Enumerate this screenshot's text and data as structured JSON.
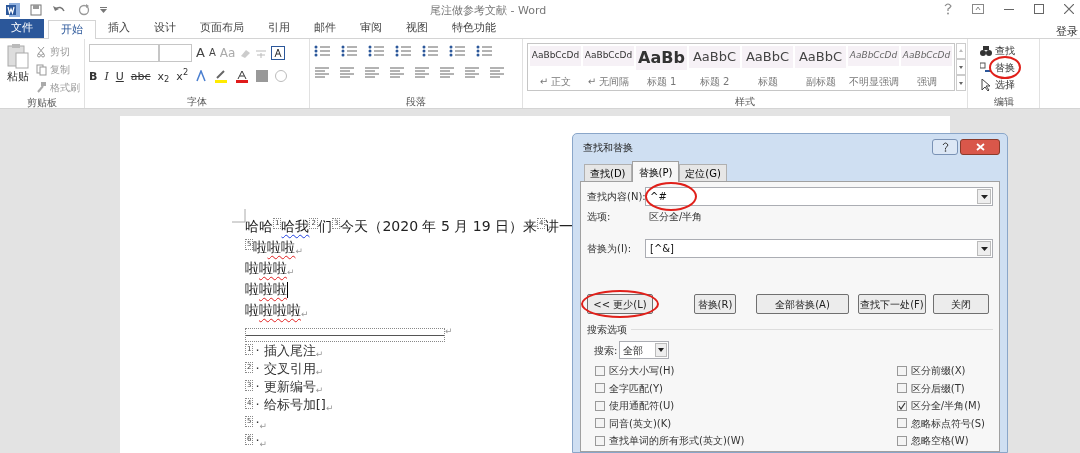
{
  "title_bar": {
    "title": "尾注做参考文献 - Word",
    "sign_in": "登录"
  },
  "tabs": [
    {
      "label": "文件",
      "kind": "file",
      "selected": false
    },
    {
      "label": "开始",
      "kind": "tab",
      "selected": true
    },
    {
      "label": "插入",
      "kind": "tab",
      "selected": false
    },
    {
      "label": "设计",
      "kind": "tab",
      "selected": false
    },
    {
      "label": "页面布局",
      "kind": "tab",
      "selected": false
    },
    {
      "label": "引用",
      "kind": "tab",
      "selected": false
    },
    {
      "label": "邮件",
      "kind": "tab",
      "selected": false
    },
    {
      "label": "审阅",
      "kind": "tab",
      "selected": false
    },
    {
      "label": "视图",
      "kind": "tab",
      "selected": false
    },
    {
      "label": "特色功能",
      "kind": "tab",
      "selected": false
    }
  ],
  "ribbon": {
    "clipboard": {
      "paste": "粘贴",
      "items": [
        "剪切",
        "复制",
        "格式刷"
      ],
      "label": "剪贴板"
    },
    "font": {
      "row1_text": [
        "A",
        "A",
        "Aa"
      ],
      "row2_text": [
        "B",
        "I",
        "U",
        "abc",
        "x$_{2}$",
        "x$^{2}$"
      ],
      "label": "字体"
    },
    "paragraph": {
      "label": "段落"
    },
    "styles": {
      "items": [
        {
          "sample": "AaBbCcDd",
          "name": "↵ 正文",
          "kind": "body"
        },
        {
          "sample": "AaBbCcDd",
          "name": "↵ 无间隔",
          "kind": "body"
        },
        {
          "sample": "AaBb",
          "name": "标题 1",
          "kind": "heading1"
        },
        {
          "sample": "AaBbC",
          "name": "标题 2",
          "kind": "heading"
        },
        {
          "sample": "AaBbC",
          "name": "标题",
          "kind": "heading"
        },
        {
          "sample": "AaBbC",
          "name": "副标题",
          "kind": "heading"
        },
        {
          "sample": "AaBbCcDd",
          "name": "不明显强调",
          "kind": "emphasis"
        },
        {
          "sample": "AaBbCcDd",
          "name": "强调",
          "kind": "emphasis"
        }
      ],
      "label": "样式"
    },
    "editing": {
      "items": [
        {
          "label": "查找",
          "kind": "find",
          "circled": false
        },
        {
          "label": "替换",
          "kind": "replace",
          "circled": true
        },
        {
          "label": "选择",
          "kind": "select",
          "circled": false
        }
      ],
      "label": "编辑"
    }
  },
  "document": {
    "lines": [
      {
        "segments": [
          {
            "kind": "text",
            "text": "哈哈",
            "spelling_error": false,
            "grammar_error": false
          },
          {
            "kind": "note_ref",
            "text": "1"
          },
          {
            "kind": "text",
            "text": "哈我",
            "spelling_error": false,
            "grammar_error": true
          },
          {
            "kind": "note_ref",
            "text": "2"
          },
          {
            "kind": "text",
            "text": "们",
            "spelling_error": false,
            "grammar_error": false
          },
          {
            "kind": "note_ref",
            "text": "3"
          },
          {
            "kind": "text",
            "text": "今天（2020 年 5 月 19 日）来",
            "spelling_error": false,
            "grammar_error": false
          },
          {
            "kind": "note_ref",
            "text": "4"
          },
          {
            "kind": "text",
            "text": "讲一",
            "spelling_error": false,
            "grammar_error": false
          }
        ],
        "cursor": false
      },
      {
        "segments": [
          {
            "kind": "note_ref",
            "text": "5"
          },
          {
            "kind": "text",
            "text": "啦",
            "spelling_error": false,
            "grammar_error": false
          },
          {
            "kind": "text",
            "text": "啦啦",
            "spelling_error": true,
            "grammar_error": false
          }
        ],
        "end_mark": "↵",
        "cursor": false
      },
      {
        "segments": [
          {
            "kind": "text",
            "text": "啦",
            "spelling_error": false,
            "grammar_error": false
          },
          {
            "kind": "text",
            "text": "啦啦",
            "spelling_error": true,
            "grammar_error": false
          }
        ],
        "end_mark": "↵",
        "cursor": false
      },
      {
        "segments": [
          {
            "kind": "text",
            "text": "啦",
            "spelling_error": false,
            "grammar_error": false
          },
          {
            "kind": "text",
            "text": "啦啦",
            "spelling_error": true,
            "grammar_error": false
          }
        ],
        "cursor": true
      },
      {
        "segments": [
          {
            "kind": "text",
            "text": "啦",
            "spelling_error": false,
            "grammar_error": false
          },
          {
            "kind": "text",
            "text": "啦啦啦",
            "spelling_error": true,
            "grammar_error": false
          }
        ],
        "end_mark": "↵",
        "cursor": false
      }
    ],
    "separator_mark": "↵",
    "notes": [
      {
        "ref": "1",
        "text": "· 插入尾注",
        "end_mark": "↵"
      },
      {
        "ref": "2",
        "text": "· 交叉引用",
        "end_mark": "↵"
      },
      {
        "ref": "3",
        "text": "· 更新编号",
        "end_mark": "↵"
      },
      {
        "ref": "4",
        "text": "· 给标号加[]",
        "end_mark": "↵"
      },
      {
        "ref": "5",
        "text": "·",
        "end_mark": "↵"
      },
      {
        "ref": "6",
        "text": "·",
        "end_mark": "↵"
      }
    ]
  },
  "dialog": {
    "title": "查找和替换",
    "tabs": [
      {
        "label": "查找(D)",
        "selected": false
      },
      {
        "label": "替换(P)",
        "selected": true
      },
      {
        "label": "定位(G)",
        "selected": false
      }
    ],
    "find": {
      "label": "查找内容(N):",
      "value": "^#",
      "circled": true
    },
    "options_label": "选项:",
    "options_value": "区分全/半角",
    "replace": {
      "label": "替换为(I):",
      "value": "[^&]"
    },
    "buttons": [
      {
        "label": "<< 更少(L)",
        "circled": true
      },
      {
        "label": "替换(R)",
        "circled": false
      },
      {
        "label": "全部替换(A)",
        "circled": false
      },
      {
        "label": "查找下一处(F)",
        "circled": false
      },
      {
        "label": "关闭",
        "circled": false
      }
    ],
    "search_options_title": "搜索选项",
    "search_label": "搜索:",
    "search_value": "全部",
    "left_options": [
      {
        "label": "区分大小写(H)",
        "checked": false
      },
      {
        "label": "全字匹配(Y)",
        "checked": false
      },
      {
        "label": "使用通配符(U)",
        "checked": false
      },
      {
        "label": "同音(英文)(K)",
        "checked": false
      },
      {
        "label": "查找单词的所有形式(英文)(W)",
        "checked": false
      }
    ],
    "right_options": [
      {
        "label": "区分前缀(X)",
        "checked": false
      },
      {
        "label": "区分后缀(T)",
        "checked": false
      },
      {
        "label": "区分全/半角(M)",
        "checked": true
      },
      {
        "label": "忽略标点符号(S)",
        "checked": false
      },
      {
        "label": "忽略空格(W)",
        "checked": false
      }
    ]
  }
}
